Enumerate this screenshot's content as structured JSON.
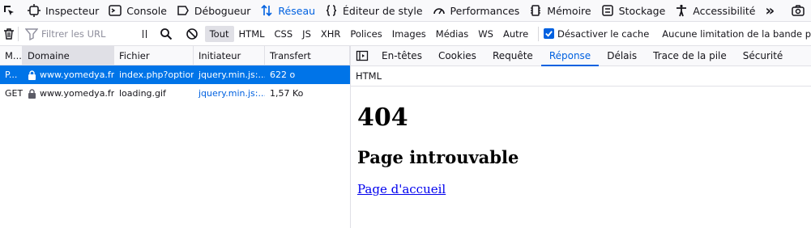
{
  "toolbar": {
    "tools": [
      {
        "label": "Inspecteur",
        "icon": "inspector-icon",
        "active": false
      },
      {
        "label": "Console",
        "icon": "console-icon",
        "active": false
      },
      {
        "label": "Débogueur",
        "icon": "debugger-icon",
        "active": false
      },
      {
        "label": "Réseau",
        "icon": "network-icon",
        "active": true
      },
      {
        "label": "Éditeur de style",
        "icon": "style-editor-icon",
        "active": false
      },
      {
        "label": "Performances",
        "icon": "performance-icon",
        "active": false
      },
      {
        "label": "Mémoire",
        "icon": "memory-icon",
        "active": false
      },
      {
        "label": "Stockage",
        "icon": "storage-icon",
        "active": false
      },
      {
        "label": "Accessibilité",
        "icon": "accessibility-icon",
        "active": false
      }
    ],
    "overflow": "»"
  },
  "filterbar": {
    "url_placeholder": "Filtrer les URL",
    "types": [
      {
        "label": "Tout",
        "on": true
      },
      {
        "label": "HTML"
      },
      {
        "label": "CSS"
      },
      {
        "label": "JS"
      },
      {
        "label": "XHR"
      },
      {
        "label": "Polices"
      },
      {
        "label": "Images"
      },
      {
        "label": "Médias"
      },
      {
        "label": "WS"
      },
      {
        "label": "Autre"
      }
    ],
    "disable_cache_label": "Désactiver le cache",
    "throttle_label": "Aucune limitation de la bande p"
  },
  "requests": {
    "columns": [
      "M...",
      "Domaine",
      "Fichier",
      "Initiateur",
      "Transfert"
    ],
    "rows": [
      {
        "method": "P...",
        "domain": "www.yomedya.fr",
        "file": "index.php?option",
        "initiator": "jquery.min.js:...",
        "transfer": "622 o",
        "selected": true
      },
      {
        "method": "GET",
        "domain": "www.yomedya.fr",
        "file": "loading.gif",
        "initiator": "jquery.min.js:...",
        "transfer": "1,57 Ko",
        "selected": false
      }
    ]
  },
  "details": {
    "tabs": [
      {
        "label": "En-têtes"
      },
      {
        "label": "Cookies"
      },
      {
        "label": "Requête"
      },
      {
        "label": "Réponse",
        "active": true
      },
      {
        "label": "Délais"
      },
      {
        "label": "Trace de la pile"
      },
      {
        "label": "Sécurité"
      }
    ],
    "subtitle": "HTML",
    "preview": {
      "h1": "404",
      "h2": "Page introuvable",
      "link": "Page d'accueil"
    }
  },
  "colors": {
    "accent": "#0061e0",
    "selected_row": "#0074e8"
  }
}
